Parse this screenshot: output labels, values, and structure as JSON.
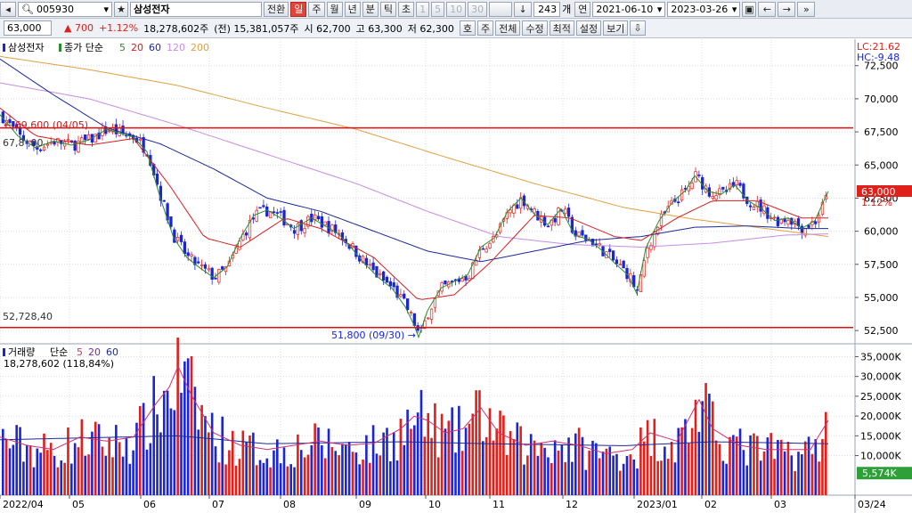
{
  "toolbar": {
    "code": "005930",
    "name": "삼성전자",
    "switch_label": "전환",
    "periods": [
      "일",
      "주",
      "월",
      "년",
      "분",
      "틱",
      "초"
    ],
    "active_period": "일",
    "intervals": [
      "1",
      "5",
      "10",
      "30"
    ],
    "count": "243",
    "count_unit": "개",
    "link_label": "연",
    "date_from": "2021-06-10",
    "date_to": "2023-03-26"
  },
  "quote": {
    "price": "63,000",
    "change": "▲ 700",
    "change_pct": "+1.12%",
    "volume": "18,278,602주",
    "prev_volume": "(전) 15,381,057주",
    "open": "시 62,700",
    "high": "고 63,300",
    "low": "저 62,300",
    "buttons": [
      "호",
      "주",
      "전체",
      "수정",
      "최적",
      "설정",
      "보기"
    ]
  },
  "price_panel": {
    "legend_name": "삼성전자",
    "legend_ma_label": "종가 단순",
    "ma_labels": [
      "5",
      "20",
      "60",
      "120",
      "200"
    ],
    "lc": "LC:21.62",
    "hc": "HC:-9.48",
    "high_note": "69,600 (04/05)",
    "line_top_label": "67,8 ,00",
    "line_bottom_label": "52,728,40",
    "low_note": "51,800 (09/30)",
    "last_price": "63,000",
    "last_pct": "1.12%",
    "y_ticks": [
      "72,500",
      "70,000",
      "67,500",
      "65,000",
      "62,500",
      "60,000",
      "57,500",
      "55,000",
      "52,500"
    ]
  },
  "volume_panel": {
    "legend_name": "거래량",
    "legend_ma_label": "단순",
    "ma_labels": [
      "5",
      "20",
      "60"
    ],
    "value_note": "18,278,602 (118,84%)",
    "last_badge": "5,574K",
    "y_ticks": [
      "35,000K",
      "30,000K",
      "25,000K",
      "20,000K",
      "15,000K",
      "10,000K"
    ]
  },
  "x_labels": [
    "2022/04",
    "05",
    "06",
    "07",
    "08",
    "09",
    "10",
    "11",
    "12",
    "2023/01",
    "02",
    "03",
    "03/24"
  ],
  "colors": {
    "up": "#e0211b",
    "down": "#1b25d6",
    "ma5": "#2c8a2c",
    "ma20": "#d42020",
    "ma60": "#1b2a9a",
    "ma120": "#c78de0",
    "ma200": "#e0a040",
    "hline": "#e01010"
  },
  "chart_data": {
    "type": "candlestick",
    "title": "삼성전자",
    "price_range": [
      51500,
      74500
    ],
    "volume_range": [
      0,
      36000
    ],
    "volume_unit": "K",
    "horizontal_lines": [
      67800,
      52728
    ],
    "price_keypoints": [
      [
        0,
        68800
      ],
      [
        20,
        67200
      ],
      [
        40,
        66300
      ],
      [
        60,
        66800
      ],
      [
        80,
        66500
      ],
      [
        100,
        66900
      ],
      [
        120,
        67700
      ],
      [
        130,
        67500
      ],
      [
        150,
        67100
      ],
      [
        165,
        66000
      ],
      [
        180,
        62500
      ],
      [
        195,
        59500
      ],
      [
        210,
        58000
      ],
      [
        225,
        57200
      ],
      [
        240,
        56500
      ],
      [
        255,
        57300
      ],
      [
        270,
        59500
      ],
      [
        285,
        61200
      ],
      [
        300,
        61600
      ],
      [
        315,
        61000
      ],
      [
        330,
        60200
      ],
      [
        350,
        61000
      ],
      [
        365,
        60400
      ],
      [
        380,
        59800
      ],
      [
        395,
        58700
      ],
      [
        410,
        57500
      ],
      [
        425,
        56500
      ],
      [
        440,
        55700
      ],
      [
        455,
        54300
      ],
      [
        465,
        52900
      ],
      [
        470,
        52000
      ],
      [
        480,
        54000
      ],
      [
        495,
        55700
      ],
      [
        510,
        56200
      ],
      [
        525,
        56700
      ],
      [
        540,
        58800
      ],
      [
        555,
        59500
      ],
      [
        570,
        61500
      ],
      [
        585,
        62500
      ],
      [
        600,
        61300
      ],
      [
        615,
        60500
      ],
      [
        630,
        61700
      ],
      [
        645,
        59700
      ],
      [
        660,
        59400
      ],
      [
        675,
        58600
      ],
      [
        690,
        57600
      ],
      [
        705,
        56700
      ],
      [
        715,
        55300
      ],
      [
        725,
        58700
      ],
      [
        740,
        60800
      ],
      [
        755,
        62200
      ],
      [
        770,
        63100
      ],
      [
        780,
        64200
      ],
      [
        795,
        63000
      ],
      [
        810,
        62800
      ],
      [
        825,
        63500
      ],
      [
        840,
        62300
      ],
      [
        855,
        61700
      ],
      [
        870,
        60800
      ],
      [
        885,
        61000
      ],
      [
        900,
        60200
      ],
      [
        915,
        60800
      ],
      [
        925,
        62300
      ],
      [
        930,
        63000
      ]
    ],
    "ma20_keypoints": [
      [
        0,
        69300
      ],
      [
        40,
        67200
      ],
      [
        100,
        66500
      ],
      [
        150,
        67000
      ],
      [
        190,
        63500
      ],
      [
        230,
        59500
      ],
      [
        270,
        58800
      ],
      [
        320,
        61000
      ],
      [
        360,
        60200
      ],
      [
        420,
        58000
      ],
      [
        470,
        54800
      ],
      [
        510,
        55200
      ],
      [
        550,
        57600
      ],
      [
        600,
        61200
      ],
      [
        640,
        61000
      ],
      [
        690,
        59600
      ],
      [
        720,
        59300
      ],
      [
        760,
        61000
      ],
      [
        800,
        62300
      ],
      [
        850,
        62300
      ],
      [
        900,
        61000
      ],
      [
        930,
        61000
      ]
    ],
    "ma60_keypoints": [
      [
        0,
        73000
      ],
      [
        60,
        70300
      ],
      [
        120,
        67800
      ],
      [
        180,
        66600
      ],
      [
        240,
        64700
      ],
      [
        300,
        62500
      ],
      [
        360,
        61500
      ],
      [
        420,
        60000
      ],
      [
        480,
        58500
      ],
      [
        540,
        57700
      ],
      [
        600,
        58500
      ],
      [
        660,
        59300
      ],
      [
        720,
        59600
      ],
      [
        780,
        60300
      ],
      [
        840,
        60400
      ],
      [
        900,
        60200
      ],
      [
        930,
        60200
      ]
    ],
    "ma120_keypoints": [
      [
        0,
        71200
      ],
      [
        100,
        70000
      ],
      [
        200,
        68000
      ],
      [
        300,
        65800
      ],
      [
        400,
        63600
      ],
      [
        480,
        61500
      ],
      [
        560,
        59600
      ],
      [
        640,
        59000
      ],
      [
        720,
        58800
      ],
      [
        800,
        59100
      ],
      [
        880,
        59700
      ],
      [
        930,
        59800
      ]
    ],
    "ma200_keypoints": [
      [
        0,
        73200
      ],
      [
        100,
        72200
      ],
      [
        200,
        71000
      ],
      [
        300,
        69300
      ],
      [
        400,
        67700
      ],
      [
        500,
        65600
      ],
      [
        600,
        63600
      ],
      [
        700,
        61800
      ],
      [
        780,
        60900
      ],
      [
        860,
        60200
      ],
      [
        930,
        59600
      ]
    ],
    "volume_keypoints": [
      [
        0,
        14000
      ],
      [
        30,
        12000
      ],
      [
        60,
        11000
      ],
      [
        90,
        14000
      ],
      [
        120,
        13000
      ],
      [
        150,
        14000
      ],
      [
        175,
        22000
      ],
      [
        190,
        26000
      ],
      [
        200,
        31000
      ],
      [
        215,
        24000
      ],
      [
        240,
        15000
      ],
      [
        270,
        12000
      ],
      [
        300,
        11000
      ],
      [
        330,
        12000
      ],
      [
        360,
        13000
      ],
      [
        390,
        12000
      ],
      [
        420,
        12500
      ],
      [
        450,
        16000
      ],
      [
        465,
        19000
      ],
      [
        480,
        18000
      ],
      [
        500,
        15000
      ],
      [
        520,
        16000
      ],
      [
        540,
        21000
      ],
      [
        560,
        15000
      ],
      [
        590,
        12000
      ],
      [
        620,
        13000
      ],
      [
        650,
        12000
      ],
      [
        680,
        10000
      ],
      [
        710,
        11000
      ],
      [
        730,
        15000
      ],
      [
        760,
        13000
      ],
      [
        785,
        23000
      ],
      [
        800,
        16000
      ],
      [
        830,
        12000
      ],
      [
        860,
        11000
      ],
      [
        890,
        11000
      ],
      [
        910,
        11000
      ],
      [
        930,
        18000
      ]
    ],
    "vol_ma_keypoints": [
      [
        0,
        14000
      ],
      [
        200,
        15000
      ],
      [
        300,
        13000
      ],
      [
        450,
        13500
      ],
      [
        550,
        13000
      ],
      [
        700,
        12500
      ],
      [
        800,
        13500
      ],
      [
        930,
        13000
      ]
    ]
  }
}
